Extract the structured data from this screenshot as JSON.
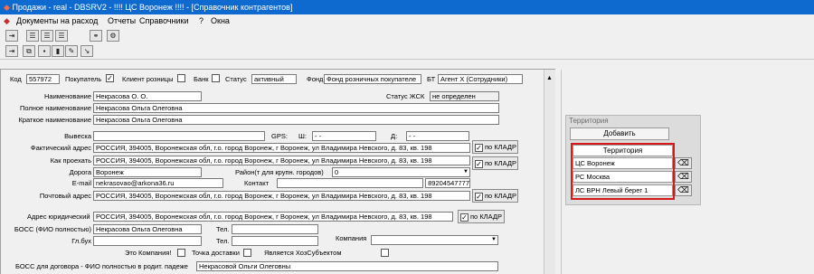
{
  "window": {
    "title": "Продажи - real - DBSRV2 -  !!!! ЦС Воронеж  !!!! - [Справочник контрагентов]"
  },
  "menu": {
    "items": [
      "Документы на расход",
      "Отчеты",
      "Справочники",
      "?",
      "Окна"
    ]
  },
  "toolbar": {
    "icons": [
      "exit-icon",
      "list-icon",
      "list-icon",
      "list-icon",
      "binoculars-icon",
      "settings-icon",
      "exit-icon",
      "copy-icon",
      "save-icon",
      "chart-icon",
      "edit-icon",
      "link-icon"
    ]
  },
  "form": {
    "kod_label": "Код",
    "kod_value": "557972",
    "pokupatel_label": "Покупатель",
    "pokupatel_checked": "✓",
    "klient_label": "Клиент розницы",
    "bank_label": "Банк",
    "status_label": "Статус",
    "status_value": "активный",
    "fond_label": "Фонд",
    "fond_value": "Фонд розничных покупателе",
    "bt_label": "БТ",
    "bt_value": "Агент Х (Сотрудники)",
    "naim_label": "Наименование",
    "naim_value": "Некрасова О. О.",
    "statuszhkh_label": "Статус ЖСК",
    "statuszhkh_value": "не определен",
    "fullname_label": "Полное наименование",
    "fullname_value": "Некрасова Ольга Олеговна",
    "shortname_label": "Краткое наименование",
    "shortname_value": "Некрасова Ольга Олеговна",
    "vyveska_label": "Вывеска",
    "gps_label": "GPS:",
    "sh_label": "Ш:",
    "sh_value": "-  -",
    "d_label": "Д:",
    "d_value": "-  -",
    "fakt_label": "Фактический адрес",
    "fakt_value": "РОССИЯ, 394005, Воронежская обл, г.о. город Воронеж, г Воронеж, ул Владимира Невского, д. 83, кв. 198",
    "kladr_label": "по КЛАДР",
    "kladr_checked": "✓",
    "kak_label": "Как проехать",
    "kak_value": "РОССИЯ, 394005, Воронежская обл, г.о. город Воронеж, г Воронеж, ул Владимира Невского, д. 83, кв. 198",
    "doroga_label": "Дорога",
    "doroga_value": "Воронеж",
    "rayon_label": "Район(т для крупн. городов)",
    "rayon_value": "0",
    "email_label": "E-mail",
    "email_value": "nekrasovao@arkona36.ru",
    "kontakt_label": "Контакт",
    "phone_value": "89204547777",
    "pocht_label": "Почтовый адрес",
    "pocht_value": "РОССИЯ, 394005, Воронежская обл, г.о. город Воронеж, г Воронеж, ул Владимира Невского, д. 83, кв. 198",
    "yur_label": "Адрес юридический",
    "yur_value": "РОССИЯ, 394005, Воронежская обл, г.о. город Воронеж, г Воронеж, ул Владимира Невского, д. 83, кв. 198",
    "boss_label": "БОСС (ФИО полностью)",
    "boss_value": "Некрасова Ольга Олеговна",
    "tel_label": "Тел.",
    "glbuh_label": "Гл.бух",
    "tel2_label": "Тел.",
    "kompaniya_label": "Компания",
    "eto_label": "Это Компания!",
    "tochka_label": "Точка доставки",
    "hoz_label": "Является ХозСубъектом",
    "bossdog_label": "БОСС для договора - ФИО полностью в родит. падеже",
    "bossdog_value": "Некрасовой Ольги Олеговны"
  },
  "territory": {
    "group_title": "Территория",
    "add_label": "Добавить",
    "header": "Территория",
    "rows": [
      "ЦС Воронеж",
      "РС Москва",
      "ЛС ВРН Левый берег 1"
    ]
  }
}
